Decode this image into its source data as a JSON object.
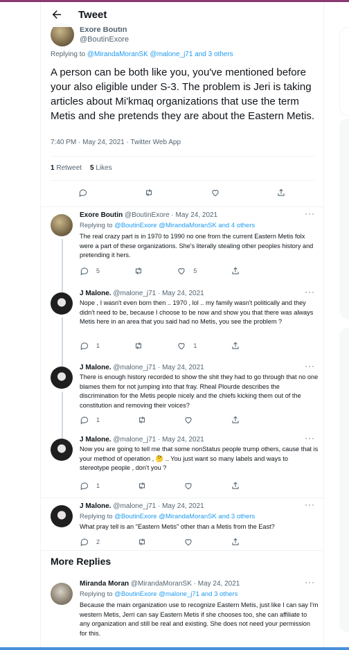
{
  "header": {
    "title": "Tweet"
  },
  "main_tweet": {
    "author_name": "Exore Boutin",
    "author_handle": "@BoutinExore",
    "replying_prefix": "Replying to ",
    "replying_to": "@MirandaMoranSK @malone_j71 and 3 others",
    "text": "A person can be both like you, you've mentioned before your also eligible under S-3.  The problem is Jeri is taking articles about Mi'kmaq organizations that use the term Metis and she pretends they are about the Eastern Metis.",
    "meta": "7:40 PM · May 24, 2021 · Twitter Web App",
    "retweets_count": "1",
    "retweets_label": "Retweet",
    "likes_count": "5",
    "likes_label": "Likes"
  },
  "replies": [
    {
      "name": "Exore Boutin",
      "handle_date": "@BoutinExore · May 24, 2021",
      "replying_to": "@BoutinExore @MirandaMoranSK and 4 others",
      "text": "The real crazy part is in 1970 to 1990 no one from the current Eastern Metis folx were a part of these organizations.  She's literally stealing other peoples history and pretending it hers.",
      "reply_count": "5",
      "retweet_count": "",
      "like_count": "5"
    },
    {
      "name": "J Malone.",
      "handle_date": "@malone_j71 · May 24, 2021",
      "replying_to": "",
      "text": "Nope , I wasn't even born then .. 1970 , lol .. my family wasn't politically and they didn't need to be, because I choose to be now and show you that there was always Metis here in an area that you said had no Metis, you see the problem ?",
      "reply_count": "1",
      "retweet_count": "",
      "like_count": "1"
    },
    {
      "name": "J Malone.",
      "handle_date": "@malone_j71 · May 24, 2021",
      "replying_to": "",
      "text": "There is enough history recorded to show the shit they had to go through that no one blames them for not jumping into that fray. Rheal Plourde describes the discrimination for the Metis people nicely and the chiefs kicking them out of the constitution and removing their voices?",
      "reply_count": "1",
      "retweet_count": "",
      "like_count": ""
    },
    {
      "name": "J Malone.",
      "handle_date": "@malone_j71 · May 24, 2021",
      "replying_to": "",
      "text": "Now you are going to tell me that some nonStatus people trump others, cause that is your method of operation , 🤔 .. You just want so many labels and ways to stereotype people , don't you ?",
      "reply_count": "1",
      "retweet_count": "",
      "like_count": ""
    },
    {
      "name": "J Malone.",
      "handle_date": "@malone_j71 · May 24, 2021",
      "replying_to": "@BoutinExore @MirandaMoranSK and 3 others",
      "text": "What pray tell is an \"Eastern Metis\" other than a Metis from the East?",
      "reply_count": "2",
      "retweet_count": "",
      "like_count": ""
    }
  ],
  "more_replies": {
    "title": "More Replies",
    "name": "Miranda Moran",
    "handle_date": "@MirandaMoranSK · May 24, 2021",
    "replying_to": "@BoutinExore @malone_j71 and 3 others",
    "text": "Because the main organization use to recognize Eastern Metis, just like I can say I'm western Metis, Jerri can say Eastern Metis if she chooses too, she can affiliate to any organization and still be real and existing. She does not need your permission for this."
  },
  "colors": {
    "accent": "#1d9bf0",
    "muted": "#536471",
    "top_bar": "#8a3a73"
  }
}
